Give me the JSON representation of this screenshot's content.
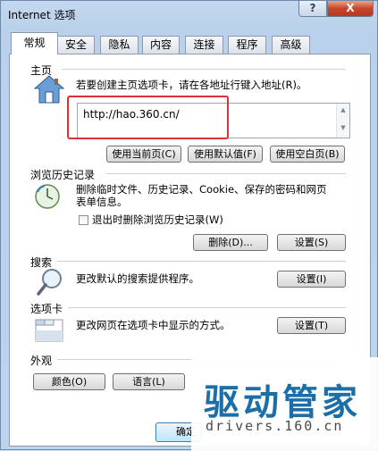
{
  "window": {
    "title": "Internet 选项",
    "help": "?",
    "close": "X"
  },
  "tabs": [
    "常规",
    "安全",
    "隐私",
    "内容",
    "连接",
    "程序",
    "高级"
  ],
  "home": {
    "heading": "主页",
    "instruction": "若要创建主页选项卡，请在各地址行键入地址(R)。",
    "url": "http://hao.360.cn/",
    "buttons": [
      "使用当前页(C)",
      "使用默认值(F)",
      "使用空白页(B)"
    ]
  },
  "history": {
    "heading": "浏览历史记录",
    "line1": "删除临时文件、历史记录、Cookie、保存的密码和网页",
    "line2": "表单信息。",
    "checkbox": "退出时删除浏览历史记录(W)",
    "delete_button": "删除(D)...",
    "settings_button": "设置(S)"
  },
  "search": {
    "heading": "搜索",
    "text": "更改默认的搜索提供程序。",
    "settings_button": "设置(I)"
  },
  "tabs_section": {
    "heading": "选项卡",
    "text": "更改网页在选项卡中显示的方式。",
    "settings_button": "设置(T)"
  },
  "appearance": {
    "heading": "外观",
    "colors_button": "颜色(O)",
    "languages_button": "语言(L)"
  },
  "footer": {
    "ok_button": "确定"
  },
  "watermark": {
    "main": "驱动管家",
    "sub": "drivers.160.cn"
  },
  "colors": {
    "accent": "#1b6ea8",
    "highlight": "#e0303a"
  }
}
